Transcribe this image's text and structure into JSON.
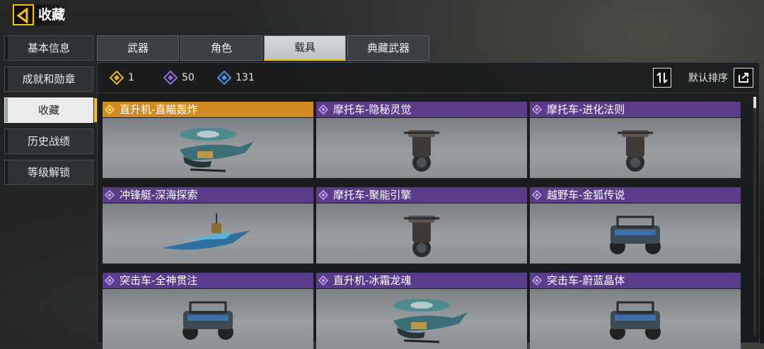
{
  "header": {
    "title": "收藏"
  },
  "sidebar": {
    "items": [
      {
        "label": "基本信息",
        "active": false
      },
      {
        "label": "成就和勋章",
        "active": false
      },
      {
        "label": "收藏",
        "active": true
      },
      {
        "label": "历史战绩",
        "active": false
      },
      {
        "label": "等级解锁",
        "active": false
      }
    ]
  },
  "tabs": [
    {
      "label": "武器",
      "active": false
    },
    {
      "label": "角色",
      "active": false
    },
    {
      "label": "载具",
      "active": true
    },
    {
      "label": "典藏武器",
      "active": false
    }
  ],
  "stats": [
    {
      "icon": "legendary-diamond-icon",
      "color": "#e9b322",
      "count": "1"
    },
    {
      "icon": "epic-diamond-icon",
      "color": "#9a6ee0",
      "count": "50"
    },
    {
      "icon": "rare-diamond-icon",
      "color": "#4b95e2",
      "count": "131"
    }
  ],
  "toolbar": {
    "sort_label": "默认排序"
  },
  "colors": {
    "accent": "#f2c01b",
    "legendary": "#d08a23",
    "epic": "#5a3c8a"
  },
  "vehicles": [
    {
      "name": "直升机-直瞄轰炸",
      "rarity": "legendary",
      "type": "helicopter"
    },
    {
      "name": "摩托车-隐秘灵觉",
      "rarity": "epic",
      "type": "motorcycle"
    },
    {
      "name": "摩托车-进化法则",
      "rarity": "epic",
      "type": "motorcycle"
    },
    {
      "name": "冲锋艇-深海探索",
      "rarity": "epic",
      "type": "boat"
    },
    {
      "name": "摩托车-聚能引擎",
      "rarity": "epic",
      "type": "motorcycle"
    },
    {
      "name": "越野车-金狐传说",
      "rarity": "epic",
      "type": "buggy"
    },
    {
      "name": "突击车-全神贯注",
      "rarity": "epic",
      "type": "buggy"
    },
    {
      "name": "直升机-冰霜龙魂",
      "rarity": "epic",
      "type": "helicopter"
    },
    {
      "name": "突击车-蔚蓝晶体",
      "rarity": "epic",
      "type": "buggy"
    }
  ]
}
